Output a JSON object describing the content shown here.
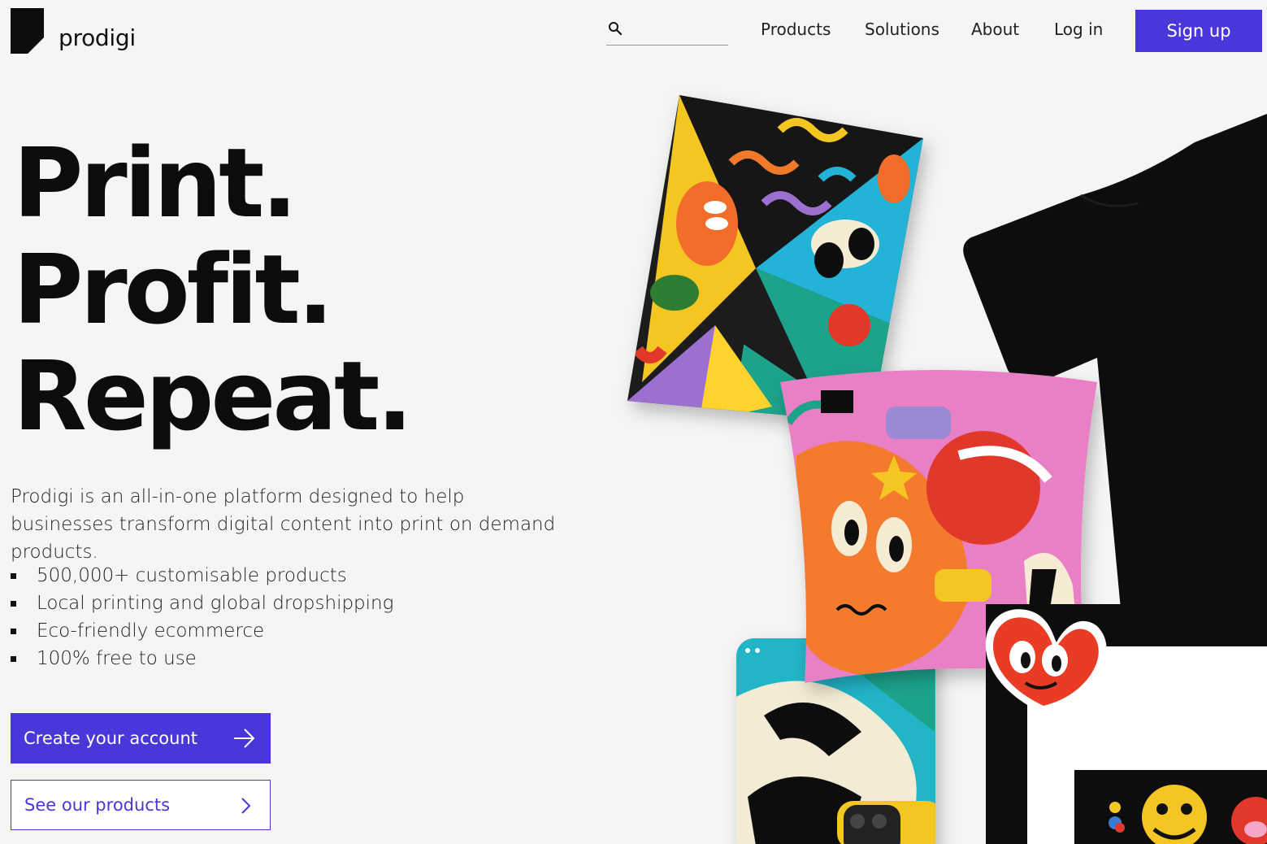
{
  "brand": {
    "name": "prodigi",
    "accent": "#4a37d9"
  },
  "header": {
    "search": {
      "placeholder": "",
      "value": ""
    },
    "nav": [
      "Products",
      "Solutions",
      "About",
      "Log in"
    ],
    "signup_label": "Sign up"
  },
  "hero": {
    "headline": [
      "Print.",
      "Profit.",
      "Repeat."
    ],
    "intro": "Prodigi is an all-in-one platform designed to help businesses transform digital content into print on demand products.",
    "bullets": [
      "500,000+ customisable products",
      "Local printing and global dropshipping",
      "Eco-friendly ecommerce",
      "100% free to use"
    ],
    "primary_cta": "Create your account",
    "secondary_cta": "See our products"
  },
  "icons": {
    "search": "search-icon",
    "arrow": "arrow-right-icon",
    "chevron": "chevron-right-icon"
  },
  "collage_products": [
    "art-print",
    "t-shirt",
    "cushion",
    "phone-case",
    "framed-print",
    "heart-sticker"
  ]
}
